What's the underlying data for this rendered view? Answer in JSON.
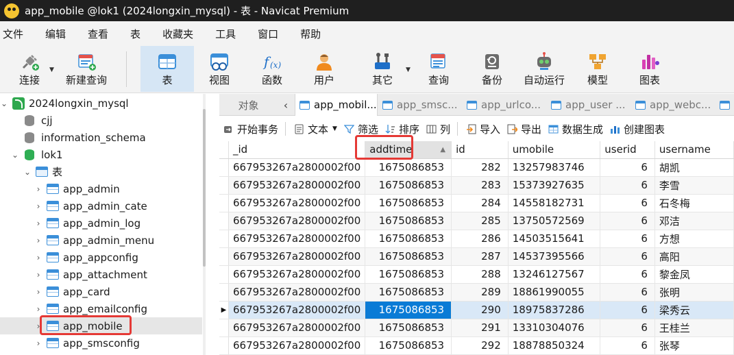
{
  "window": {
    "title": "app_mobile @lok1 (2024longxin_mysql) - 表 - Navicat Premium"
  },
  "menu": [
    "文件",
    "编辑",
    "查看",
    "表",
    "收藏夹",
    "工具",
    "窗口",
    "帮助"
  ],
  "toolbar": {
    "connect": "连接",
    "new_query": "新建查询",
    "table": "表",
    "view": "视图",
    "function": "函数",
    "user": "用户",
    "other": "其它",
    "query": "查询",
    "backup": "备份",
    "auto_run": "自动运行",
    "model": "模型",
    "chart": "图表"
  },
  "navigator": {
    "connection": "2024longxin_mysql",
    "databases": [
      "cjj",
      "information_schema",
      "lok1"
    ],
    "tables_folder": "表",
    "tables": [
      "app_admin",
      "app_admin_cate",
      "app_admin_log",
      "app_admin_menu",
      "app_appconfig",
      "app_attachment",
      "app_card",
      "app_emailconfig",
      "app_mobile",
      "app_smsconfig"
    ],
    "selected_table": "app_mobile"
  },
  "tabs": {
    "objects": "对象",
    "items": [
      "app_mobil...",
      "app_smsc...",
      "app_urlco...",
      "app_user ...",
      "app_webc..."
    ]
  },
  "datatools": {
    "begin_txn": "开始事务",
    "text": "文本",
    "filter": "筛选",
    "sort": "排序",
    "columns": "列",
    "import": "导入",
    "export": "导出",
    "data_gen": "数据生成",
    "create_chart": "创建图表"
  },
  "grid": {
    "columns": [
      "_id",
      "addtime",
      "id",
      "umobile",
      "userid",
      "username"
    ],
    "sorted_column": "addtime",
    "rows": [
      [
        "667953267a2800002f00",
        "1675086853",
        "282",
        "13257983746",
        "6",
        "胡凯"
      ],
      [
        "667953267a2800002f00",
        "1675086853",
        "283",
        "15373927635",
        "6",
        "李雪"
      ],
      [
        "667953267a2800002f00",
        "1675086853",
        "284",
        "14558182731",
        "6",
        "石冬梅"
      ],
      [
        "667953267a2800002f00",
        "1675086853",
        "285",
        "13750572569",
        "6",
        "邓洁"
      ],
      [
        "667953267a2800002f00",
        "1675086853",
        "286",
        "14503515641",
        "6",
        "方想"
      ],
      [
        "667953267a2800002f00",
        "1675086853",
        "287",
        "14537395566",
        "6",
        "高阳"
      ],
      [
        "667953267a2800002f00",
        "1675086853",
        "288",
        "13246127567",
        "6",
        "黎金凤"
      ],
      [
        "667953267a2800002f00",
        "1675086853",
        "289",
        "18861990055",
        "6",
        "张明"
      ],
      [
        "667953267a2800002f00",
        "1675086853",
        "290",
        "18975837286",
        "6",
        "梁秀云"
      ],
      [
        "667953267a2800002f00",
        "1675086853",
        "291",
        "13310304076",
        "6",
        "王桂兰"
      ],
      [
        "667953267a2800002f00",
        "1675086853",
        "292",
        "18878850324",
        "6",
        "张琴"
      ]
    ],
    "current_row": 8
  },
  "colors": {
    "accent": "#0a7bd6",
    "highlight": "#e53935"
  }
}
